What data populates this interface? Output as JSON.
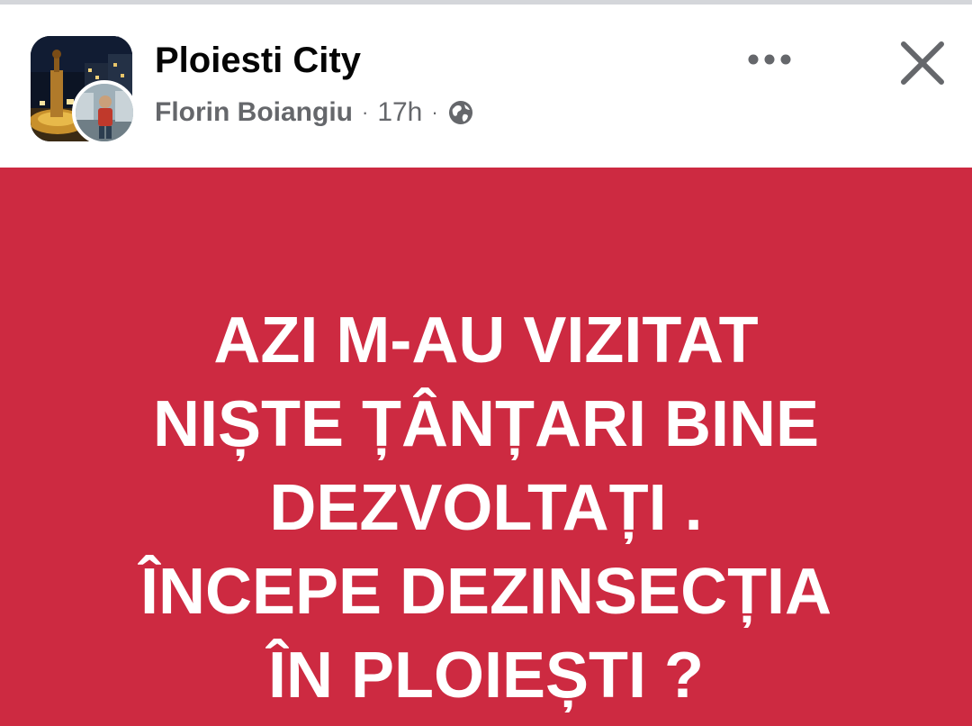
{
  "header": {
    "group_name": "Ploiesti City",
    "author": "Florin Boiangiu",
    "separator": "·",
    "time": "17h",
    "privacy_icon": "globe-icon"
  },
  "actions": {
    "more_icon": "more-horizontal-icon",
    "close_icon": "close-icon"
  },
  "post": {
    "background_color": "#cd2a41",
    "text_color": "#ffffff",
    "lines": [
      "AZI M-AU VIZITAT",
      "NIȘTE ȚÂNȚARI BINE",
      "DEZVOLTAȚI .",
      " ÎNCEPE DEZINSECȚIA",
      "ÎN PLOIEȘTI ?"
    ]
  }
}
